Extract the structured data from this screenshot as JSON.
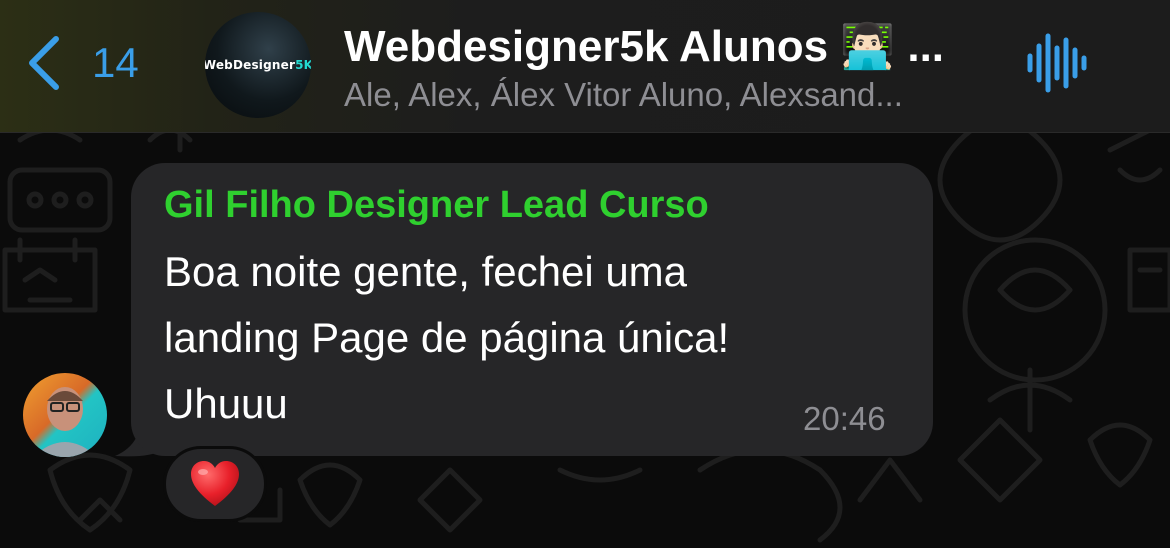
{
  "header": {
    "back_count": "14",
    "title": "Webdesigner5k Alunos 👨🏻‍💻 ...",
    "subtitle": "Ale, Alex, Álex Vitor Aluno, Alexsand...",
    "avatar_logo": {
      "prefix": "WebDesigner",
      "suffix": "5K"
    },
    "icons": {
      "back": "chevron-left-icon",
      "audio": "audio-waveform-icon"
    },
    "accent_color": "#3a9ee8"
  },
  "message": {
    "sender": "Gil Filho Designer Lead Curso",
    "sender_color": "#2fd02f",
    "text_lines": [
      "Boa noite gente, fechei uma",
      "landing Page de página única!",
      "Uhuuu"
    ],
    "time": "20:46",
    "reaction": "heart-reaction-icon"
  }
}
